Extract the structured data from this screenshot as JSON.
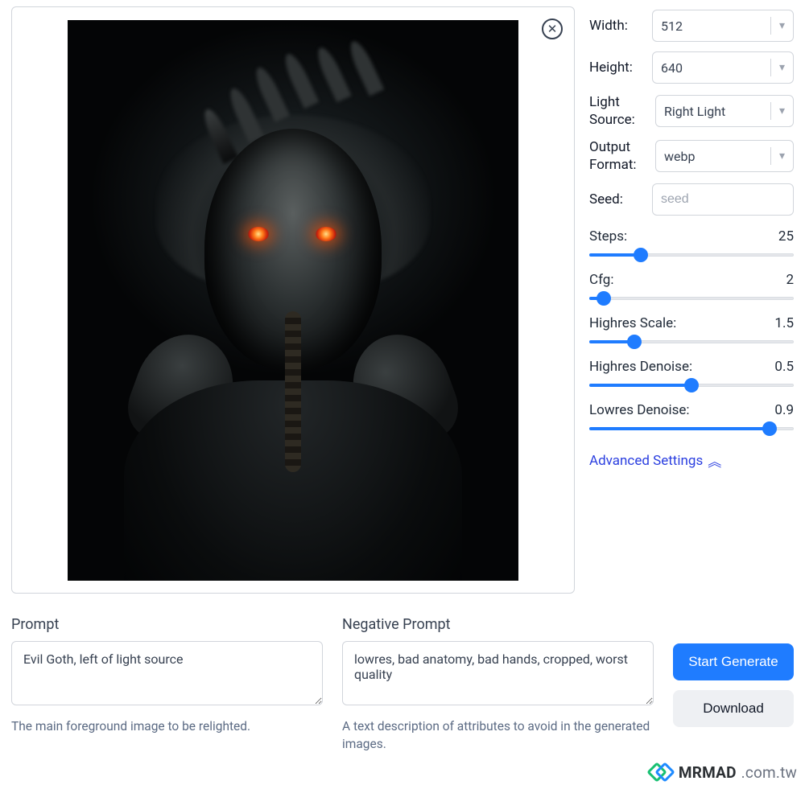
{
  "controls": {
    "width": {
      "label": "Width:",
      "value": "512"
    },
    "height": {
      "label": "Height:",
      "value": "640"
    },
    "light_source": {
      "label": "Light Source:",
      "value": "Right Light"
    },
    "output_format": {
      "label": "Output Format:",
      "value": "webp"
    },
    "seed": {
      "label": "Seed:",
      "placeholder": "seed",
      "value": ""
    },
    "steps": {
      "label": "Steps:",
      "value": 25,
      "min": 0,
      "max": 100,
      "pct": 25
    },
    "cfg": {
      "label": "Cfg:",
      "value": 2,
      "min": 0,
      "max": 30,
      "pct": 7
    },
    "hscale": {
      "label": "Highres Scale:",
      "value": 1.5,
      "min": 1,
      "max": 4,
      "pct": 22
    },
    "hdenoise": {
      "label": "Highres Denoise:",
      "value": 0.5,
      "min": 0,
      "max": 1,
      "pct": 50
    },
    "ldenoise": {
      "label": "Lowres Denoise:",
      "value": 0.9,
      "min": 0,
      "max": 1,
      "pct": 88
    },
    "advanced_label": "Advanced Settings"
  },
  "prompt": {
    "label": "Prompt",
    "value": "Evil Goth, left of light source",
    "help": "The main foreground image to be relighted."
  },
  "negative_prompt": {
    "label": "Negative Prompt",
    "value": "lowres, bad anatomy, bad hands, cropped, worst quality",
    "help": "A text description of attributes to avoid in the generated images."
  },
  "buttons": {
    "start": "Start Generate",
    "download": "Download"
  },
  "watermark": {
    "brand": "MRMAD",
    "suffix": ".com.tw"
  }
}
